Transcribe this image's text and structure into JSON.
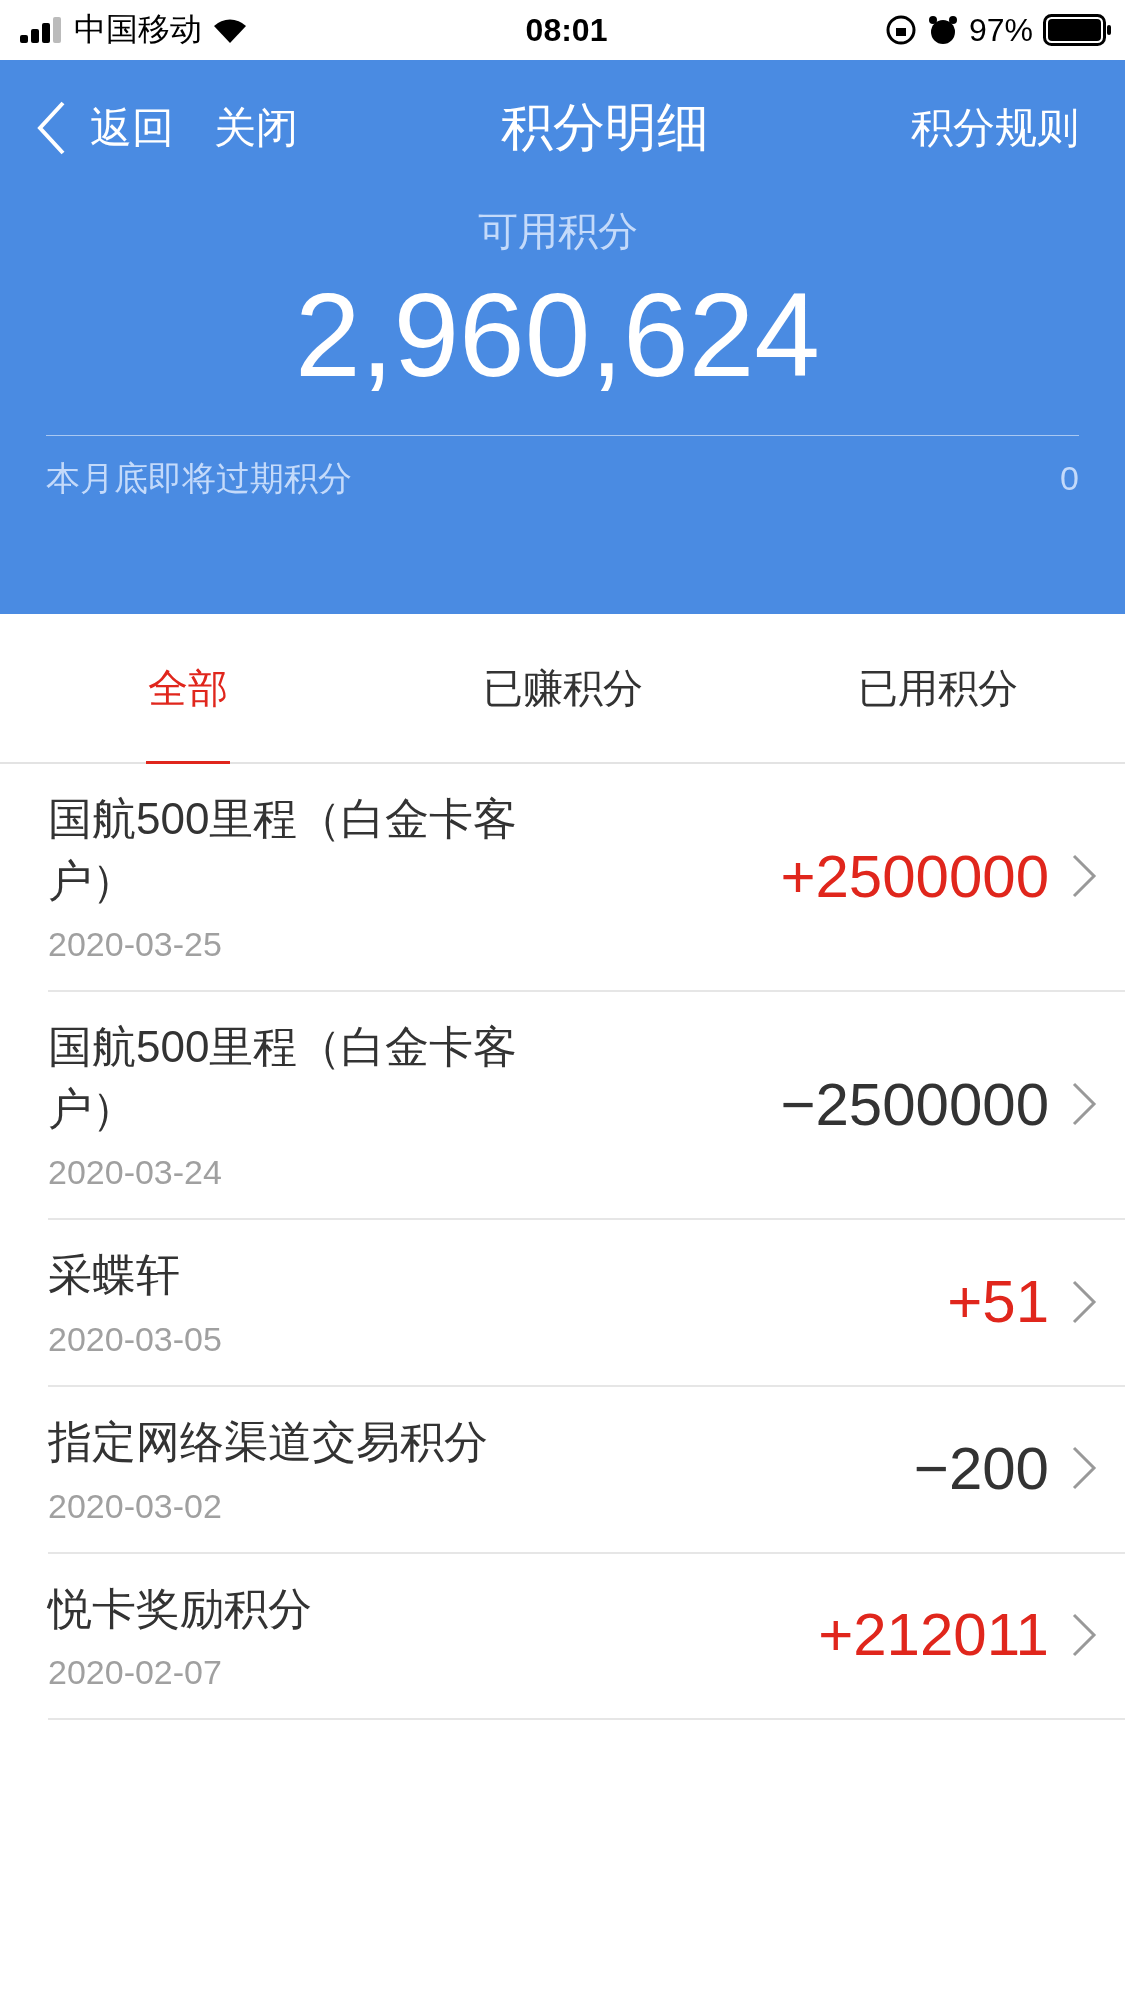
{
  "status_bar": {
    "carrier": "中国移动",
    "time": "08:01",
    "battery": "97%"
  },
  "nav": {
    "back": "返回",
    "close": "关闭",
    "title": "积分明细",
    "rules": "积分规则"
  },
  "summary": {
    "label": "可用积分",
    "points": "2,960,624",
    "expiring_label": "本月底即将过期积分",
    "expiring_value": "0"
  },
  "tabs": [
    {
      "label": "全部",
      "selected": true
    },
    {
      "label": "已赚积分",
      "selected": false
    },
    {
      "label": "已用积分",
      "selected": false
    }
  ],
  "records": [
    {
      "title": "国航500里程（白金卡客户）",
      "date": "2020-03-25",
      "amount": "+2500000",
      "kind": "credit"
    },
    {
      "title": "国航500里程（白金卡客户）",
      "date": "2020-03-24",
      "amount": "−2500000",
      "kind": "debit"
    },
    {
      "title": "采蝶轩",
      "date": "2020-03-05",
      "amount": "+51",
      "kind": "credit"
    },
    {
      "title": "指定网络渠道交易积分",
      "date": "2020-03-02",
      "amount": "−200",
      "kind": "debit"
    },
    {
      "title": "悦卡奖励积分",
      "date": "2020-02-07",
      "amount": "+212011",
      "kind": "credit"
    }
  ]
}
